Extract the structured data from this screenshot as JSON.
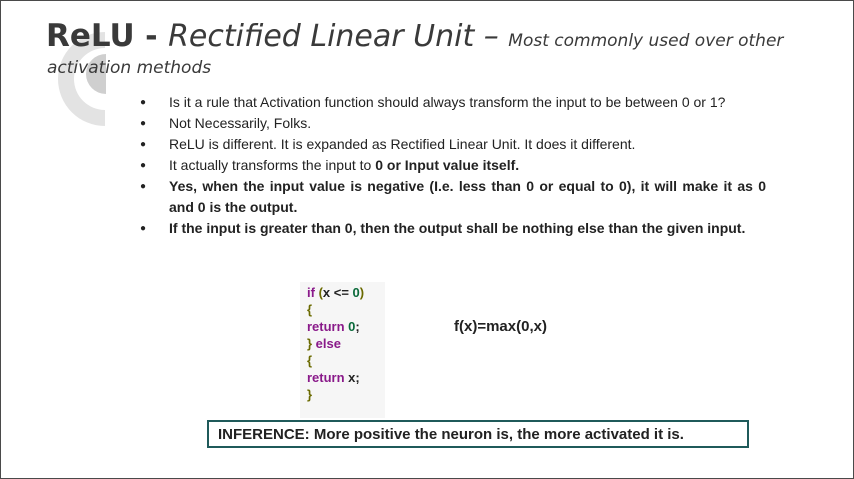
{
  "slide": {
    "title_bold": "ReLU",
    "title_sep": " - ",
    "title_italic": "Rectified Linear Unit",
    "title_dash": " – ",
    "title_small": "Most commonly used over other",
    "subtitle": "activation methods",
    "bullets": [
      {
        "text": "Is it a rule that Activation function should always transform the input to be between 0 or 1?"
      },
      {
        "text": "Not Necessarily, Folks."
      },
      {
        "text": "ReLU  is different. It is expanded as Rectified Linear Unit. It does it different."
      },
      {
        "prefix": "It actually transforms the input to ",
        "bold": "0 or Input value itself."
      },
      {
        "text": "Yes, when the input value is negative (I.e. less than 0 or equal to 0), it will make it as 0 and 0 is the output."
      },
      {
        "text": "If the input is greater than 0, then the output shall be nothing else than the given input."
      }
    ],
    "code": {
      "l1_kw": "if",
      "l1_open": " (",
      "l1_expr": "x <= ",
      "l1_num": "0",
      "l1_close": ")",
      "l2": "{",
      "l3_kw": "return ",
      "l3_num": "0",
      "l3_end": ";",
      "l4_brace": "} ",
      "l4_kw": "else",
      "l5": "{",
      "l6_kw": "return ",
      "l6_x": "x;",
      "l7": "}"
    },
    "formula": "f(x)=max(0,x)",
    "inference": "INFERENCE: More positive the neuron is, the more activated it is."
  }
}
